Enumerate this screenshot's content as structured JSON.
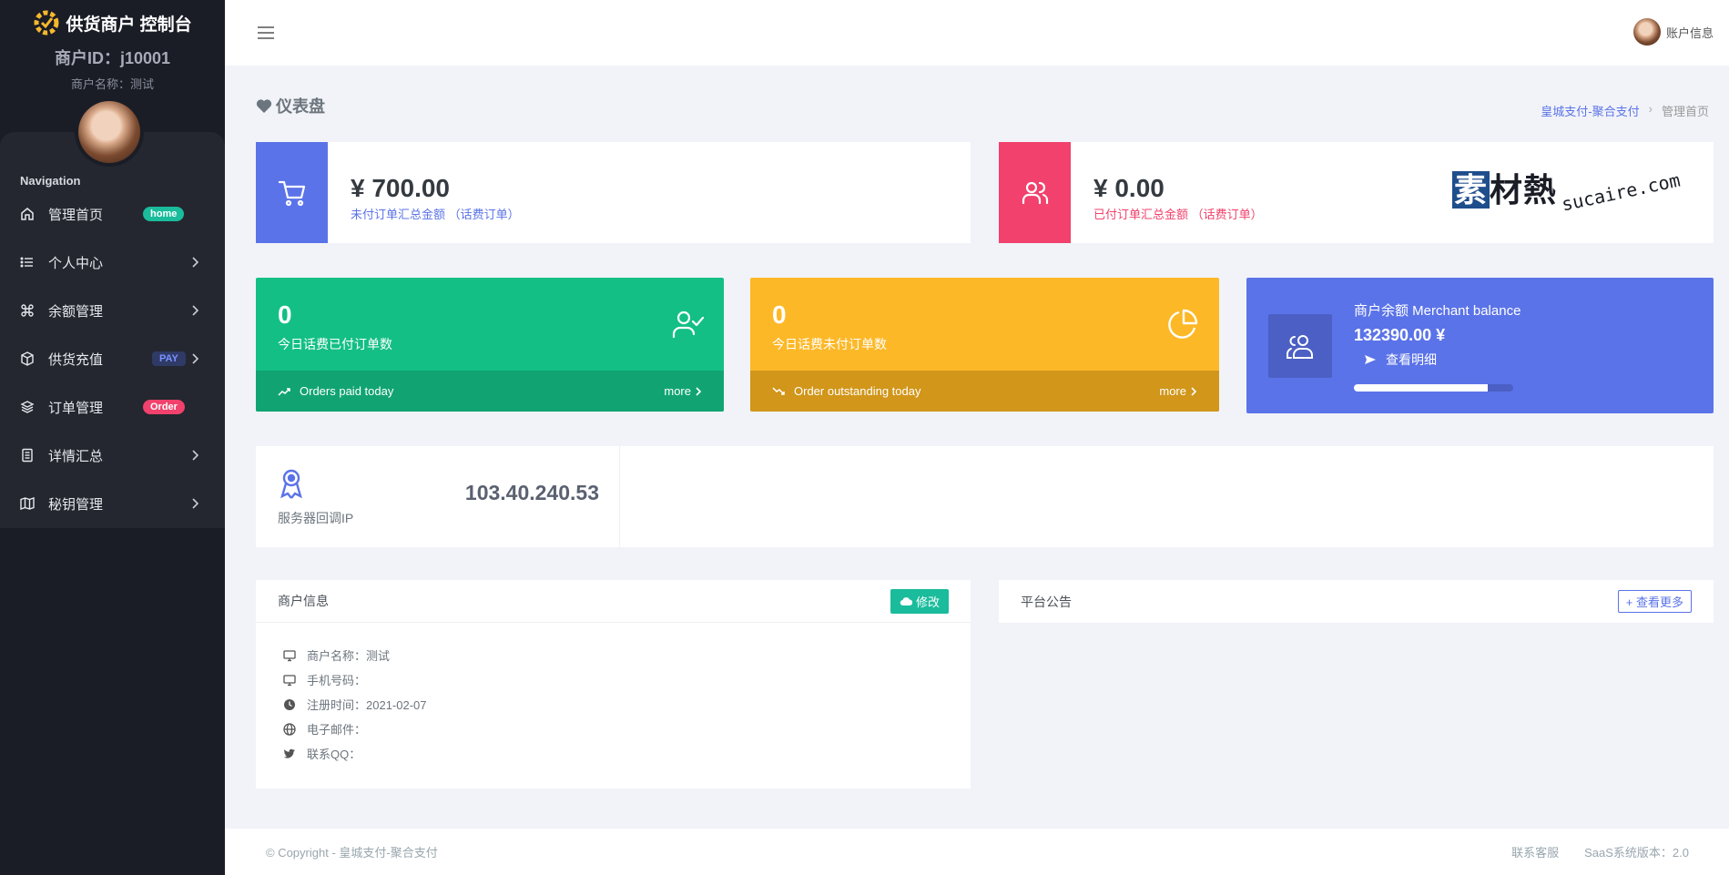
{
  "sidebar": {
    "brand_title": "供货商户 控制台",
    "merchant_id": "商户ID：j10001",
    "merchant_name": "商户名称：测试",
    "nav_heading": "Navigation",
    "items": [
      {
        "label": "管理首页",
        "icon": "home-icon",
        "badge": "home"
      },
      {
        "label": "个人中心",
        "icon": "list-icon"
      },
      {
        "label": "余额管理",
        "icon": "command-icon"
      },
      {
        "label": "供货充值",
        "icon": "box-icon",
        "badge": "PAY"
      },
      {
        "label": "订单管理",
        "icon": "layers-icon",
        "badge": "Order"
      },
      {
        "label": "详情汇总",
        "icon": "file-icon"
      },
      {
        "label": "秘钥管理",
        "icon": "map-icon"
      }
    ]
  },
  "topbar": {
    "account_label": "账户信息"
  },
  "page": {
    "title": "仪表盘",
    "breadcrumb": {
      "link": "皇城支付-聚合支付",
      "separator": "›",
      "current": "管理首页"
    }
  },
  "stats": {
    "unpaid": {
      "value": "¥ 700.00",
      "label": "未付订单汇总金额 （话费订单）",
      "color": "#5b73e8"
    },
    "paid": {
      "value": "¥ 0.00",
      "label": "已付订单汇总金额 （话费订单）",
      "color": "#f1416c"
    }
  },
  "watermark": {
    "cn_first": "素",
    "cn_rest": "材熱",
    "en": "sucaire.com"
  },
  "today": {
    "paid": {
      "value": "0",
      "label": "今日话费已付订单数",
      "footer": "Orders paid today",
      "more": "more",
      "color": "#13bf85"
    },
    "outstanding": {
      "value": "0",
      "label": "今日话费未付订单数",
      "footer": "Order outstanding today",
      "more": "more",
      "color": "#fdb827"
    }
  },
  "balance": {
    "title": "商户余额 Merchant balance",
    "amount": "132390.00 ¥",
    "detail": "查看明细",
    "progress": 0.84
  },
  "server": {
    "label": "服务器回调IP",
    "ip": "103.40.240.53"
  },
  "merchant_info": {
    "title": "商户信息",
    "edit_label": "修改",
    "rows": [
      {
        "icon": "monitor-icon",
        "text": "商户名称：测试"
      },
      {
        "icon": "monitor-icon",
        "text": "手机号码："
      },
      {
        "icon": "clock-icon",
        "text": "注册时间：2021-02-07"
      },
      {
        "icon": "globe-icon",
        "text": "电子邮件："
      },
      {
        "icon": "twitter-icon",
        "text": "联系QQ："
      }
    ]
  },
  "announcements": {
    "title": "平台公告",
    "more_label": "+ 查看更多"
  },
  "footer": {
    "copyright": "© Copyright - 皇城支付-聚合支付",
    "contact": "联系客服",
    "version": "SaaS系统版本：2.0"
  }
}
